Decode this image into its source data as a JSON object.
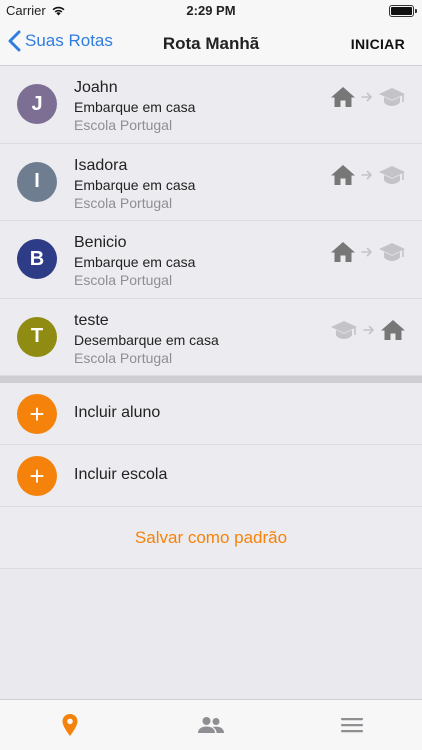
{
  "status_bar": {
    "carrier": "Carrier",
    "time": "2:29 PM"
  },
  "nav": {
    "back_label": "Suas Rotas",
    "title": "Rota Manhã",
    "action_label": "INICIAR"
  },
  "students": [
    {
      "initial": "J",
      "name": "Joahn",
      "action": "Embarque em casa",
      "school": "Escola Portugal",
      "avatar_color": "#7d6f93",
      "direction": "home-to-school"
    },
    {
      "initial": "I",
      "name": "Isadora",
      "action": "Embarque em casa",
      "school": "Escola Portugal",
      "avatar_color": "#6f7d91",
      "direction": "home-to-school"
    },
    {
      "initial": "B",
      "name": "Benicio",
      "action": "Embarque em casa",
      "school": "Escola Portugal",
      "avatar_color": "#2e3b86",
      "direction": "home-to-school"
    },
    {
      "initial": "T",
      "name": "teste",
      "action": "Desembarque em casa",
      "school": "Escola Portugal",
      "avatar_color": "#8f8b13",
      "direction": "school-to-home"
    }
  ],
  "add_student": {
    "label": "Incluir aluno"
  },
  "add_school": {
    "label": "Incluir escola"
  },
  "save_default": {
    "label": "Salvar como padrão"
  },
  "colors": {
    "accent": "#f5820b",
    "link": "#2f7ddf",
    "icon_active": "#777777",
    "icon_inactive": "#c4c4c8"
  },
  "tabs": [
    {
      "icon": "location-pin-icon",
      "active": true
    },
    {
      "icon": "people-icon",
      "active": false
    },
    {
      "icon": "menu-icon",
      "active": false
    }
  ]
}
